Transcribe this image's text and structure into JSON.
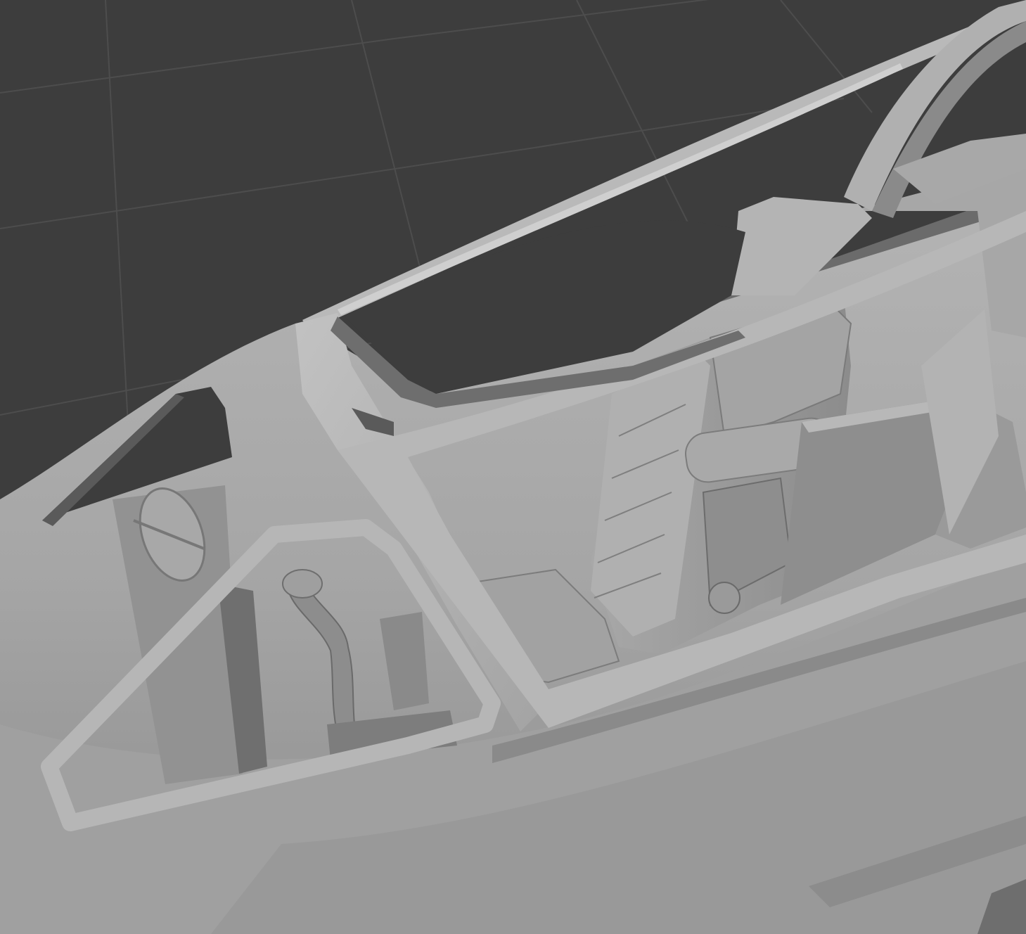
{
  "viewport": {
    "background_color": "#3d3d3d",
    "grid_line_color": "#4d4d4d",
    "model_base_color": "#9a9a9a",
    "model_highlight_color": "#bdbdbd",
    "model_shadow_color": "#5f5f5f",
    "show_grid": true
  }
}
